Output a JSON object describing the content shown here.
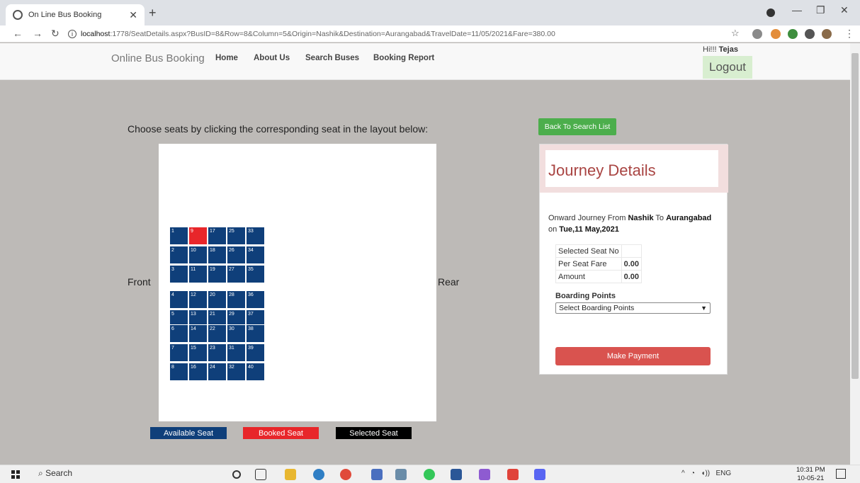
{
  "browser": {
    "tab_title": "On Line Bus Booking",
    "url_host": "localhost",
    "url_path": ":1778/SeatDetails.aspx?BusID=8&Row=8&Column=5&Origin=Nashik&Destination=Aurangabad&TravelDate=11/05/2021&Fare=380.00"
  },
  "nav": {
    "brand": "Online Bus Booking",
    "links": [
      "Home",
      "About Us",
      "Search Buses",
      "Booking Report"
    ],
    "greeting": "Hi!!! ",
    "user": "Tejas",
    "logout": "Logout"
  },
  "seats": {
    "instructions": "Choose seats by clicking the corresponding seat in the layout below:",
    "front": "Front",
    "rear": "Rear",
    "numbers": [
      "1",
      "2",
      "3",
      "4",
      "5",
      "6",
      "7",
      "8",
      "9",
      "10",
      "11",
      "12",
      "13",
      "14",
      "15",
      "16",
      "17",
      "18",
      "19",
      "20",
      "21",
      "22",
      "23",
      "24",
      "25",
      "26",
      "27",
      "28",
      "29",
      "30",
      "31",
      "32",
      "33",
      "34",
      "35",
      "36",
      "37",
      "38",
      "39",
      "40"
    ],
    "booked": [
      "9"
    ],
    "legend": {
      "available": "Available Seat",
      "booked": "Booked Seat",
      "selected": "Selected Seat"
    },
    "colors": {
      "available": "#0f3f7a",
      "booked": "#e8262a",
      "selected": "#000000"
    }
  },
  "journey": {
    "back_button": "Back To Search List",
    "title": "Journey Details",
    "onward_prefix": "Onward Journey From ",
    "origin": "Nashik",
    "to": " To ",
    "destination": "Aurangabad",
    "on": "on ",
    "date": "Tue,11 May,2021",
    "selected_seat_label": "Selected Seat No",
    "selected_seat_value": "",
    "per_seat_fare_label": "Per Seat Fare",
    "per_seat_fare_value": "0.00",
    "amount_label": "Amount",
    "amount_value": "0.00",
    "boarding_label": "Boarding Points",
    "boarding_selected": "Select Boarding Points",
    "pay_button": "Make Payment"
  },
  "taskbar": {
    "search": "Search",
    "lang": "ENG",
    "time": "10:31 PM",
    "date": "10-05-21"
  }
}
